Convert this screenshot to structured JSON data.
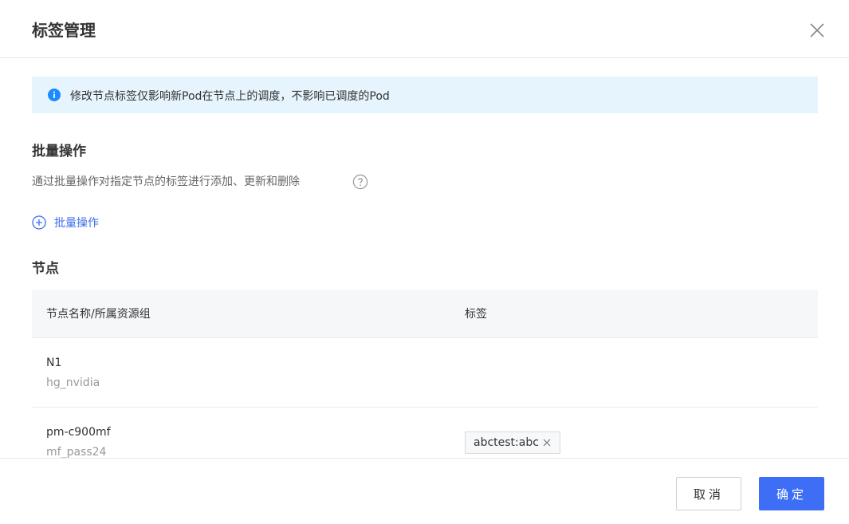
{
  "dialog": {
    "title": "标签管理"
  },
  "alert": {
    "text": "修改节点标签仅影响新Pod在节点上的调度，不影响已调度的Pod",
    "icon": "info-icon",
    "color": "#1a8cff"
  },
  "batch": {
    "title": "批量操作",
    "description": "通过批量操作对指定节点的标签进行添加、更新和删除",
    "button_label": "批量操作"
  },
  "nodes": {
    "title": "节点",
    "columns": [
      "节点名称/所属资源组",
      "标签"
    ],
    "rows": [
      {
        "name": "N1",
        "group": "hg_nvidia",
        "tags": []
      },
      {
        "name": "pm-c900mf",
        "group": "mf_pass24",
        "tags": [
          "abctest:abc"
        ]
      }
    ]
  },
  "footer": {
    "cancel_label": "取消",
    "ok_label": "确定"
  },
  "colors": {
    "accent": "#3d6ef5",
    "alert_bg": "#e6f4fd"
  }
}
